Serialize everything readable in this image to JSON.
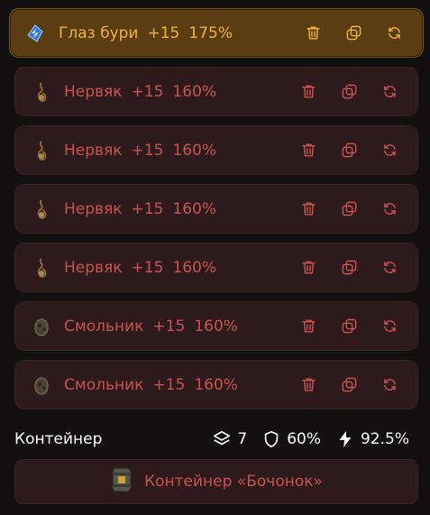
{
  "items": [
    {
      "name": "Глаз бури",
      "level": "+15",
      "percent": "175%",
      "active": true,
      "icon": "storm-eye-artifact-icon"
    },
    {
      "name": "Нервяк",
      "level": "+15",
      "percent": "160%",
      "active": false,
      "icon": "nerve-artifact-icon"
    },
    {
      "name": "Нервяк",
      "level": "+15",
      "percent": "160%",
      "active": false,
      "icon": "nerve-artifact-icon"
    },
    {
      "name": "Нервяк",
      "level": "+15",
      "percent": "160%",
      "active": false,
      "icon": "nerve-artifact-icon"
    },
    {
      "name": "Нервяк",
      "level": "+15",
      "percent": "160%",
      "active": false,
      "icon": "nerve-artifact-icon"
    },
    {
      "name": "Смольник",
      "level": "+15",
      "percent": "160%",
      "active": false,
      "icon": "resin-artifact-icon"
    },
    {
      "name": "Смольник",
      "level": "+15",
      "percent": "160%",
      "active": false,
      "icon": "resin-artifact-icon"
    }
  ],
  "summary": {
    "label": "Контейнер",
    "slots": "7",
    "protection": "60%",
    "energy": "92.5%"
  },
  "container": {
    "label": "Контейнер «Бочонок»",
    "icon": "barrel-container-icon"
  },
  "colors": {
    "background": "#121010",
    "row_bg": "#2e1a1c",
    "row_text": "#c8544f",
    "active_bg": "#5a3e12",
    "active_text": "#f0b23c"
  }
}
